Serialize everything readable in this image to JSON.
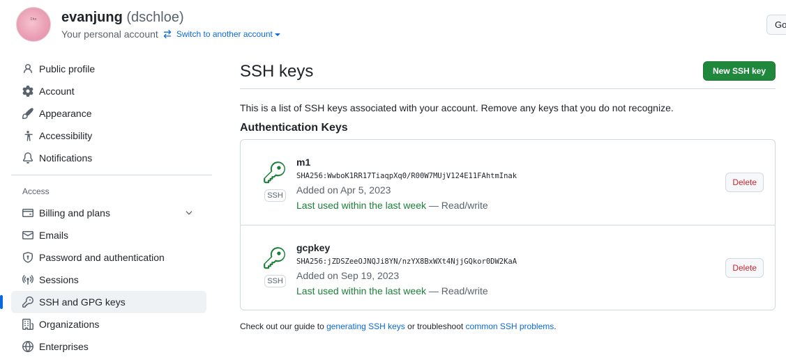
{
  "header": {
    "user_name": "evanjung",
    "user_handle": "(dschloe)",
    "account_label": "Your personal account",
    "switch_label": "Switch to another account",
    "goto_button": "Go to your personal profile",
    "avatar_text": "Cho"
  },
  "sidebar": {
    "items": [
      {
        "label": "Public profile",
        "icon": "person-icon"
      },
      {
        "label": "Account",
        "icon": "gear-icon"
      },
      {
        "label": "Appearance",
        "icon": "paintbrush-icon"
      },
      {
        "label": "Accessibility",
        "icon": "accessibility-icon"
      },
      {
        "label": "Notifications",
        "icon": "bell-icon"
      }
    ],
    "access_heading": "Access",
    "access_items": [
      {
        "label": "Billing and plans",
        "icon": "credit-card-icon"
      },
      {
        "label": "Emails",
        "icon": "mail-icon"
      },
      {
        "label": "Password and authentication",
        "icon": "shield-lock-icon"
      },
      {
        "label": "Sessions",
        "icon": "broadcast-icon"
      },
      {
        "label": "SSH and GPG keys",
        "icon": "key-icon"
      },
      {
        "label": "Organizations",
        "icon": "organization-icon"
      },
      {
        "label": "Enterprises",
        "icon": "globe-icon"
      }
    ],
    "active_item": "SSH and GPG keys"
  },
  "main": {
    "title": "SSH keys",
    "new_button": "New SSH key",
    "intro": "This is a list of SSH keys associated with your account. Remove any keys that you do not recognize.",
    "section_title": "Authentication Keys",
    "keys": [
      {
        "name": "m1",
        "fingerprint": "SHA256:WwboK1RR17TiaqpXq0/R00W7MUjV124E11FAhtmInak",
        "added": "Added on Apr 5, 2023",
        "last_used": "Last used within the last week",
        "access": " — Read/write",
        "badge": "SSH",
        "delete_label": "Delete"
      },
      {
        "name": "gcpkey",
        "fingerprint": "SHA256:jZDSZeeOJNQJi8YN/nzYX8BxWXt4NjjGQkor0DW2KaA",
        "added": "Added on Sep 19, 2023",
        "last_used": "Last used within the last week",
        "access": " — Read/write",
        "badge": "SSH",
        "delete_label": "Delete"
      }
    ],
    "footer": {
      "prefix": "Check out our guide to ",
      "link1": "generating SSH keys",
      "middle": " or troubleshoot ",
      "link2": "common SSH problems",
      "suffix": "."
    }
  },
  "colors": {
    "accent": "#0969da",
    "primary_button": "#1f883d",
    "success_text": "#1a7f37",
    "danger_text": "#d1242f"
  }
}
